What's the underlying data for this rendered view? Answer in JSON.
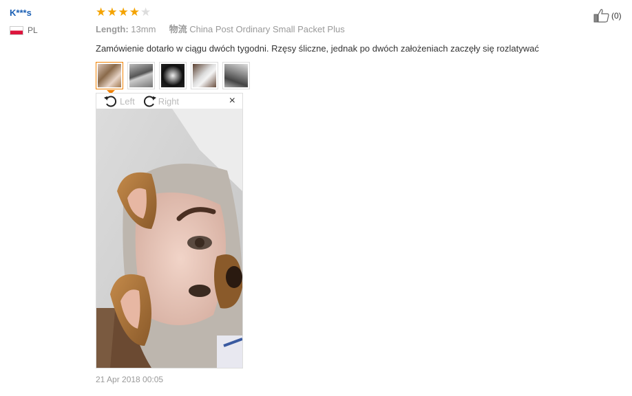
{
  "user": {
    "name": "K***s",
    "country": "PL"
  },
  "rating": {
    "value": 4,
    "max": 5
  },
  "meta": {
    "length_label": "Length:",
    "length_value": "13mm",
    "shipping_label": "物流",
    "shipping_value": "China Post Ordinary Small Packet Plus"
  },
  "review_text": "Zamówienie dotarło w ciągu dwóch tygodni. Rzęsy śliczne, jednak po dwóch założeniach zaczęły się rozlatywać",
  "thumbnails": [
    {
      "id": 1,
      "active": true
    },
    {
      "id": 2,
      "active": false
    },
    {
      "id": 3,
      "active": false
    },
    {
      "id": 4,
      "active": false
    },
    {
      "id": 5,
      "active": false
    }
  ],
  "viewer": {
    "rotate_left": "Left",
    "rotate_right": "Right",
    "close": "×"
  },
  "date": "21 Apr 2018 00:05",
  "helpful": {
    "count": "(0)"
  },
  "colors": {
    "accent": "#f08000",
    "star": "#f4a300",
    "link": "#1a5fb4"
  }
}
